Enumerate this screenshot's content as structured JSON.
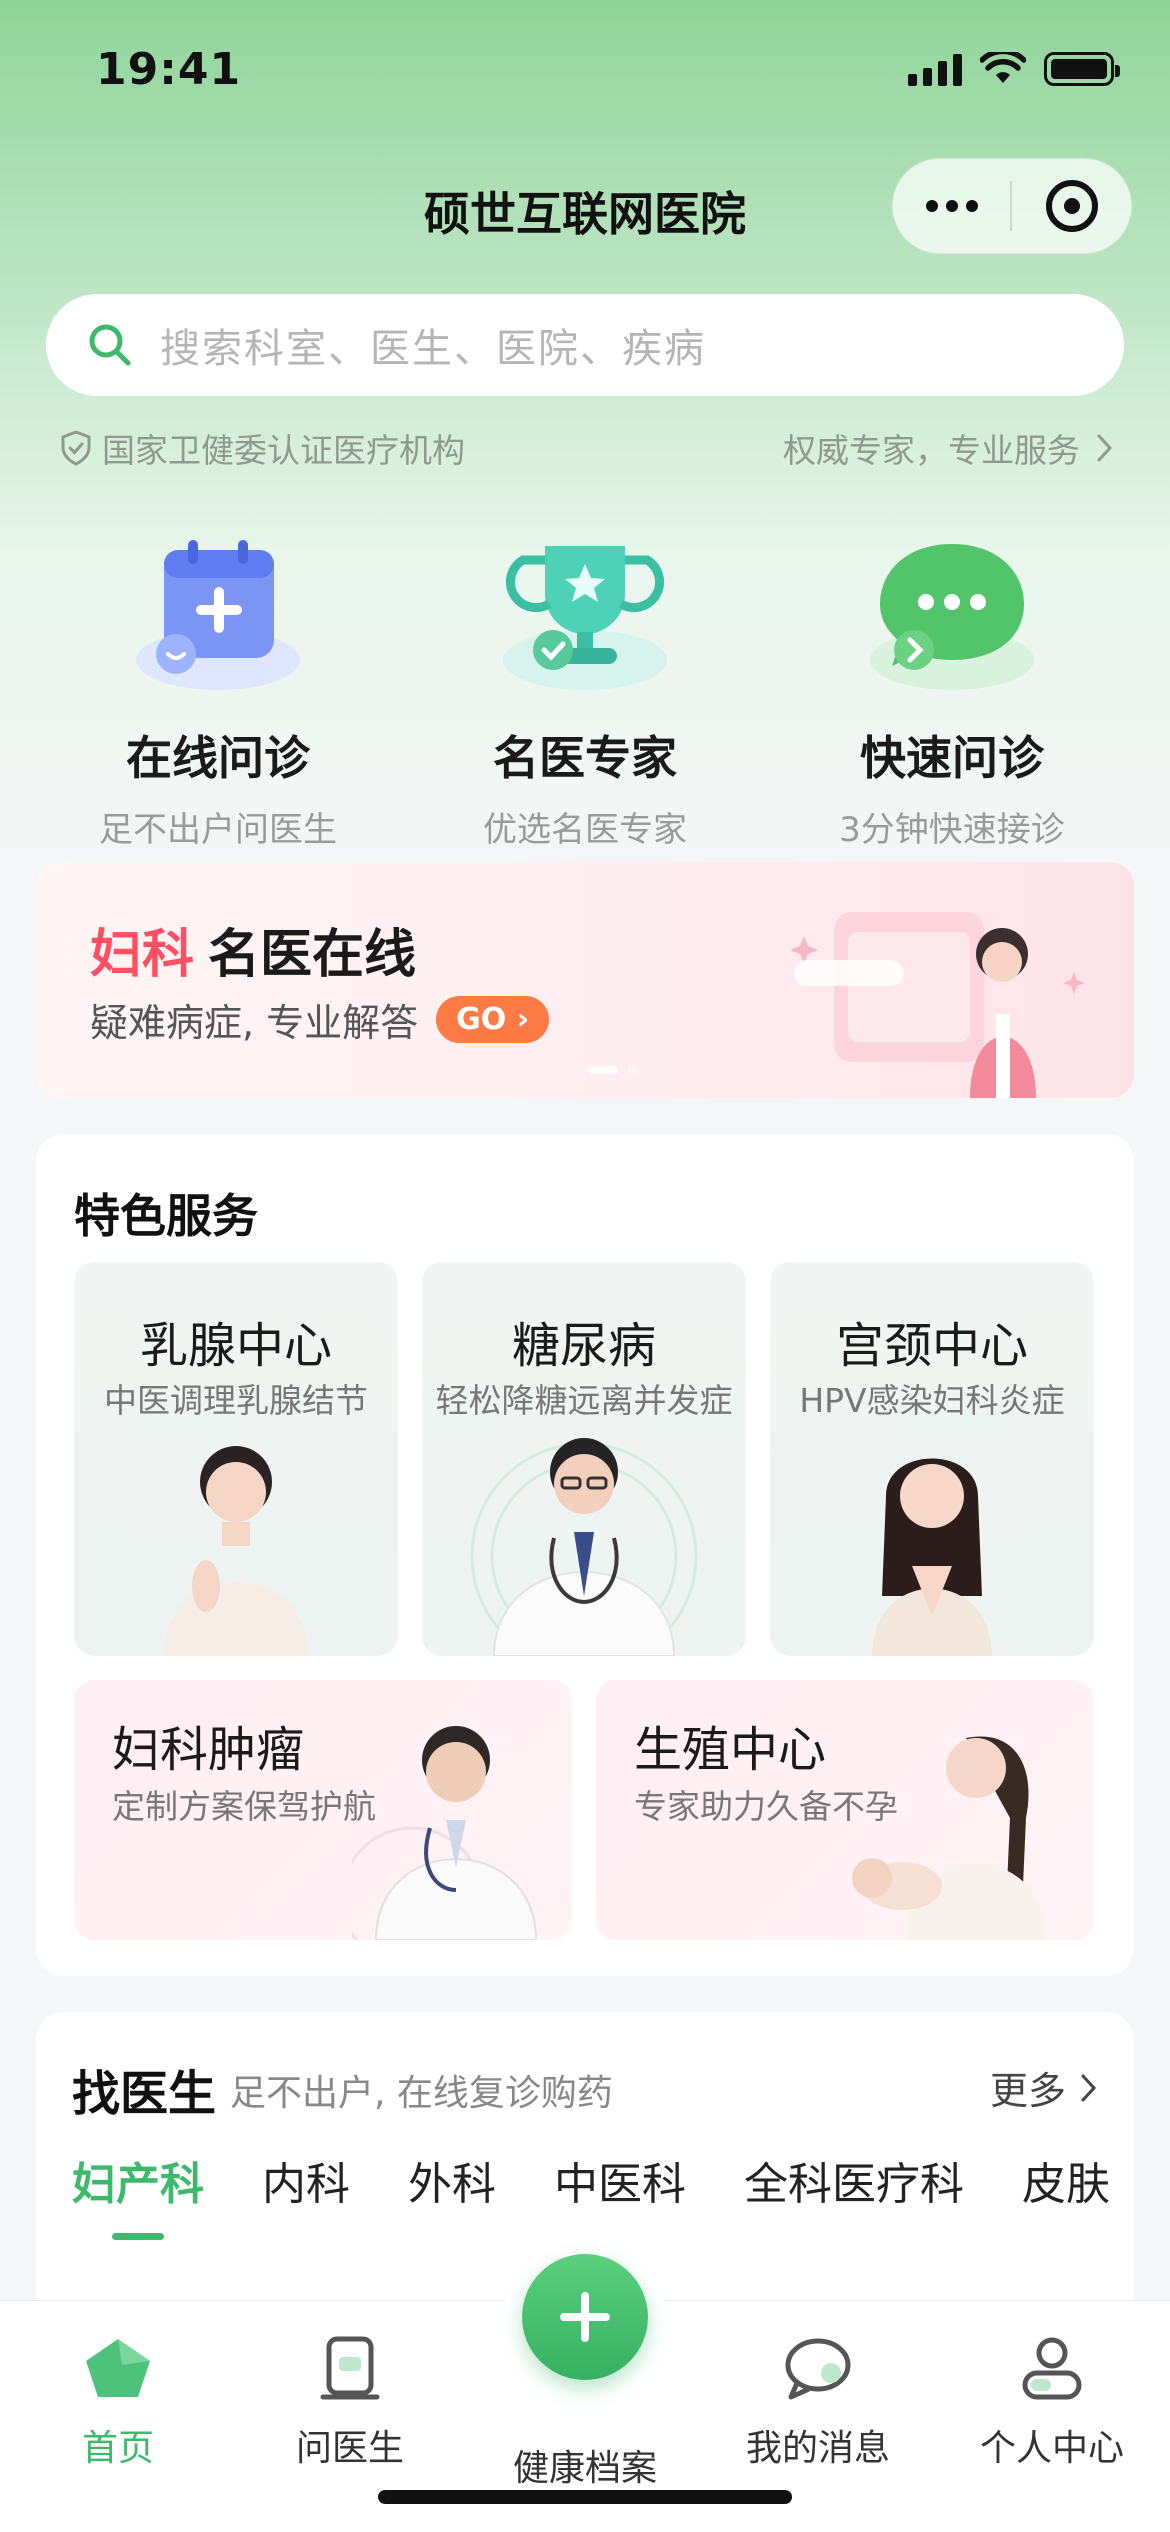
{
  "status_bar": {
    "time": "19:41"
  },
  "nav": {
    "title": "硕世互联网医院"
  },
  "search": {
    "placeholder": "搜索科室、医生、医院、疾病"
  },
  "certification": {
    "left": "国家卫健委认证医疗机构",
    "right": "权威专家，专业服务"
  },
  "entries": [
    {
      "title": "在线问诊",
      "subtitle": "足不出户问医生",
      "icon": "calendar-plus-icon"
    },
    {
      "title": "名医专家",
      "subtitle": "优选名医专家",
      "icon": "trophy-icon"
    },
    {
      "title": "快速问诊",
      "subtitle": "3分钟快速接诊",
      "icon": "chat-bubble-icon"
    }
  ],
  "banner": {
    "highlight": "妇科",
    "title": "名医在线",
    "subtitle": "疑难病症, 专业解答",
    "cta": "GO"
  },
  "featured": {
    "title": "特色服务",
    "cards": [
      {
        "title": "乳腺中心",
        "subtitle": "中医调理乳腺结节"
      },
      {
        "title": "糖尿病",
        "subtitle": "轻松降糖远离并发症"
      },
      {
        "title": "宫颈中心",
        "subtitle": "HPV感染妇科炎症"
      },
      {
        "title": "妇科肿瘤",
        "subtitle": "定制方案保驾护航"
      },
      {
        "title": "生殖中心",
        "subtitle": "专家助力久备不孕"
      }
    ]
  },
  "find_doctor": {
    "title": "找医生",
    "subtitle": "足不出户, 在线复诊购药",
    "more": "更多",
    "tabs": [
      "妇产科",
      "内科",
      "外科",
      "中医科",
      "全科医疗科",
      "皮肤"
    ],
    "active_tab": "妇产科"
  },
  "tab_bar": {
    "items": [
      {
        "label": "首页",
        "icon": "home-icon"
      },
      {
        "label": "问医生",
        "icon": "doctor-icon"
      },
      {
        "label": "健康档案",
        "icon": "plus-icon"
      },
      {
        "label": "我的消息",
        "icon": "message-icon"
      },
      {
        "label": "个人中心",
        "icon": "user-icon"
      }
    ],
    "active": "首页"
  },
  "colors": {
    "brand_green": "#3db96b",
    "highlight_red": "#ff4f63",
    "go_orange": "#ff7a45"
  }
}
